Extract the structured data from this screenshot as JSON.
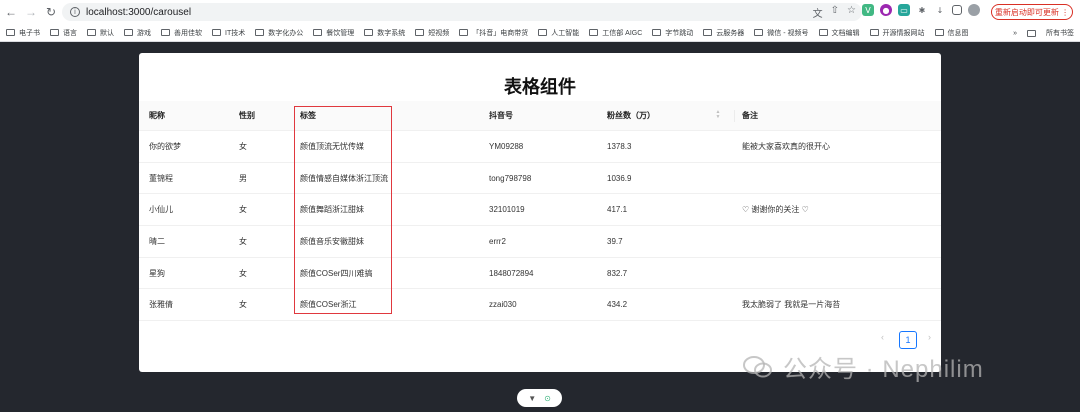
{
  "browser": {
    "url": "localhost:3000/carousel",
    "update_button": "重新启动即可更新 ⋮",
    "bookmarks": [
      "电子书",
      "语言",
      "默认",
      "游戏",
      "善用佳软",
      "IT技术",
      "数字化办公",
      "餐饮管理",
      "数字系统",
      "短视频",
      "「抖音」电商带货",
      "人工智能",
      "工信部 AIGC",
      "字节跳动",
      "云服务器",
      "微信 - 视频号",
      "文档编辑",
      "开源情报网站",
      "信息图"
    ],
    "all_bookmarks": "所有书签",
    "more": "»"
  },
  "page": {
    "title": "表格组件",
    "columns": [
      "昵称",
      "性别",
      "标签",
      "抖音号",
      "粉丝数（万）",
      "备注"
    ],
    "rows": [
      [
        "你的欲梦",
        "女",
        "颜值顶流无忧传媒",
        "YM09288",
        "1378.3",
        "能被大家喜欢真的很开心"
      ],
      [
        "董锦程",
        "男",
        "颜值情感自媒体浙江顶流",
        "tong798798",
        "1036.9",
        ""
      ],
      [
        "小仙儿",
        "女",
        "颜值舞蹈浙江甜妹",
        "32101019",
        "417.1",
        "♡ 谢谢你的关注 ♡"
      ],
      [
        "晴二",
        "女",
        "颜值音乐安徽甜妹",
        "errr2",
        "39.7",
        ""
      ],
      [
        "星狗",
        "女",
        "颜值COSer四川难搞",
        "1848072894",
        "832.7",
        ""
      ],
      [
        "张雅倩",
        "女",
        "颜值COSer浙江",
        "zzai030",
        "434.2",
        "我太脆弱了 我就是一片海苔"
      ]
    ],
    "pagination": {
      "prev": "‹",
      "current": "1",
      "next": "›"
    }
  },
  "watermark": {
    "text": "公众号 · Nephilim"
  },
  "icons": {
    "back": "←",
    "forward": "→",
    "reload": "↻",
    "star": "☆",
    "share": "⇧",
    "translate": "文",
    "download": "↓",
    "colors": {
      "accent": "#1677ff",
      "highlight": "#e0383e",
      "update": "#d93025",
      "background": "#24272e"
    }
  }
}
